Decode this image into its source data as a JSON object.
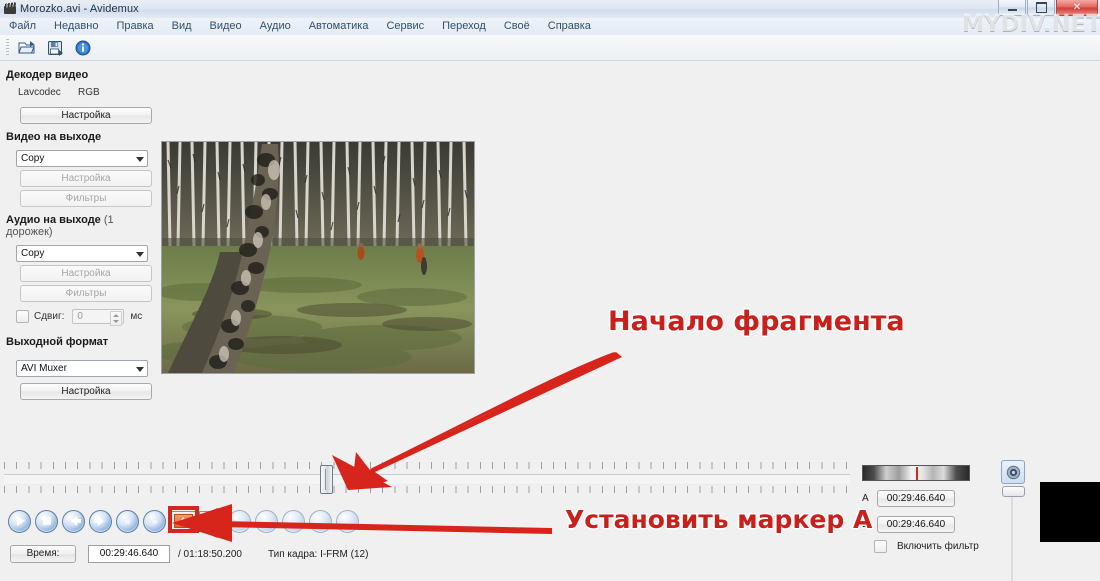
{
  "window": {
    "title": "Morozko.avi - Avidemux",
    "app_icon": "film-clapper-icon",
    "minimize": "—",
    "maximize": "❐",
    "close": "✕"
  },
  "watermark": "MYDIV.NET",
  "menubar": {
    "items": [
      {
        "label": "Файл"
      },
      {
        "label": "Недавно"
      },
      {
        "label": "Правка"
      },
      {
        "label": "Вид"
      },
      {
        "label": "Видео"
      },
      {
        "label": "Аудио"
      },
      {
        "label": "Автоматика"
      },
      {
        "label": "Сервис"
      },
      {
        "label": "Переход"
      },
      {
        "label": "Своё"
      },
      {
        "label": "Справка"
      }
    ]
  },
  "toolbar": {
    "buttons": [
      {
        "icon": "open-folder-icon",
        "tooltip": "Открыть"
      },
      {
        "icon": "save-floppy-icon",
        "tooltip": "Сохранить"
      },
      {
        "icon": "info-icon",
        "tooltip": "Информация"
      }
    ]
  },
  "left_panel": {
    "decoder": {
      "title": "Декодер видео",
      "codec": "Lavcodec",
      "colorspace": "RGB",
      "config_button": "Настройка"
    },
    "video_output": {
      "title": "Видео на выходе",
      "mode": "Copy",
      "config_button": "Настройка",
      "filters_button": "Фильтры"
    },
    "audio_output": {
      "title": "Аудио на выходе",
      "title_sub": "(1 дорожек)",
      "mode": "Copy",
      "config_button": "Настройка",
      "filters_button": "Фильтры",
      "shift_label": "Сдвиг:",
      "shift_value": "0",
      "shift_unit": "мс",
      "shift_checked": false
    },
    "output_format": {
      "title": "Выходной формат",
      "muxer": "AVI Muxer",
      "config_button": "Настройка"
    }
  },
  "preview": {
    "scene": "birch-forest-frame",
    "alt": "Кадр видео: берёзовый лес"
  },
  "timeline": {
    "handle_position_pct": 37.4,
    "ticks": true
  },
  "nav_buttons": [
    {
      "name": "play-button",
      "icon": "play-icon"
    },
    {
      "name": "stop-button",
      "icon": "stop-icon"
    },
    {
      "name": "previous-frame-button",
      "icon": "arrow-left-icon"
    },
    {
      "name": "next-frame-button",
      "icon": "arrow-right-icon"
    },
    {
      "name": "previous-keyframe-button",
      "icon": "double-arrow-left-icon"
    },
    {
      "name": "next-keyframe-button",
      "icon": "double-arrow-right-icon"
    },
    {
      "name": "set-marker-a-button",
      "icon": "marker-a-icon",
      "label": "A"
    },
    {
      "name": "set-marker-b-button",
      "icon": "marker-b-icon",
      "label": "B"
    },
    {
      "name": "nav-button-9",
      "icon": "circle-icon"
    },
    {
      "name": "nav-button-10",
      "icon": "circle-icon"
    },
    {
      "name": "nav-button-11",
      "icon": "circle-icon"
    },
    {
      "name": "nav-button-12",
      "icon": "circle-icon"
    },
    {
      "name": "nav-button-13",
      "icon": "circle-icon"
    }
  ],
  "status": {
    "time_button": "Время:",
    "current_time": "00:29:46.640",
    "total_time": "/ 01:18:50.200",
    "frame_type_label": "Тип кадра:",
    "frame_type_value": "I-FRM (12)",
    "frame_type_full": "Тип кадра:  I-FRM (12)"
  },
  "markers": {
    "a_label": "A",
    "a_value": "00:29:46.640",
    "b_label": "B:",
    "b_value": "00:29:46.640",
    "filter_checkbox_label": "Включить фильтр",
    "filter_checked": false
  },
  "volume": {
    "icon": "speaker-icon",
    "level_pct": 78
  },
  "annotations": [
    {
      "id": "anno1",
      "text": "Начало фрагмента",
      "color": "#c9201b"
    },
    {
      "id": "anno2",
      "text": "Установить маркер A",
      "color": "#c9201b"
    }
  ],
  "highlight": {
    "target": "set-marker-a-button",
    "color": "#d8251c"
  }
}
